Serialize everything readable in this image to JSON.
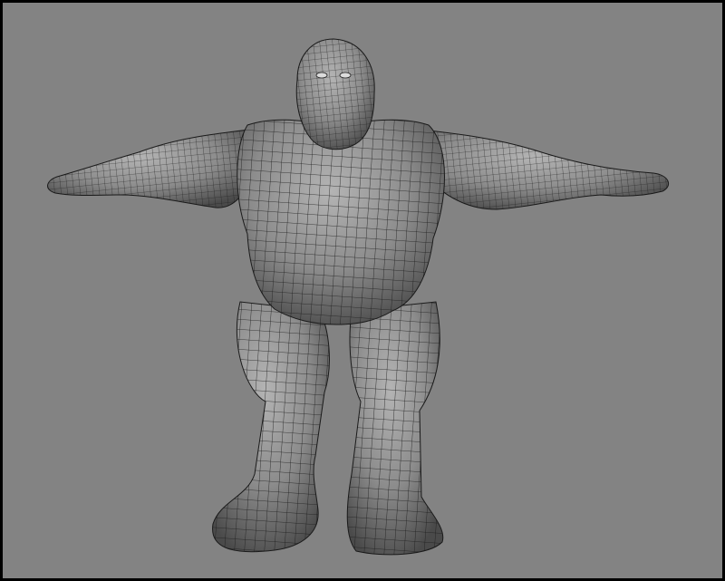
{
  "viewport": {
    "background": "#838383",
    "border": "#000000",
    "shading_mode": "smooth-shade-wireframe-on-shaded"
  },
  "model": {
    "kind": "character-mesh",
    "pose": "t-pose",
    "surface_color": "#8f8f8f",
    "wire_color": "#1a1a1a"
  }
}
